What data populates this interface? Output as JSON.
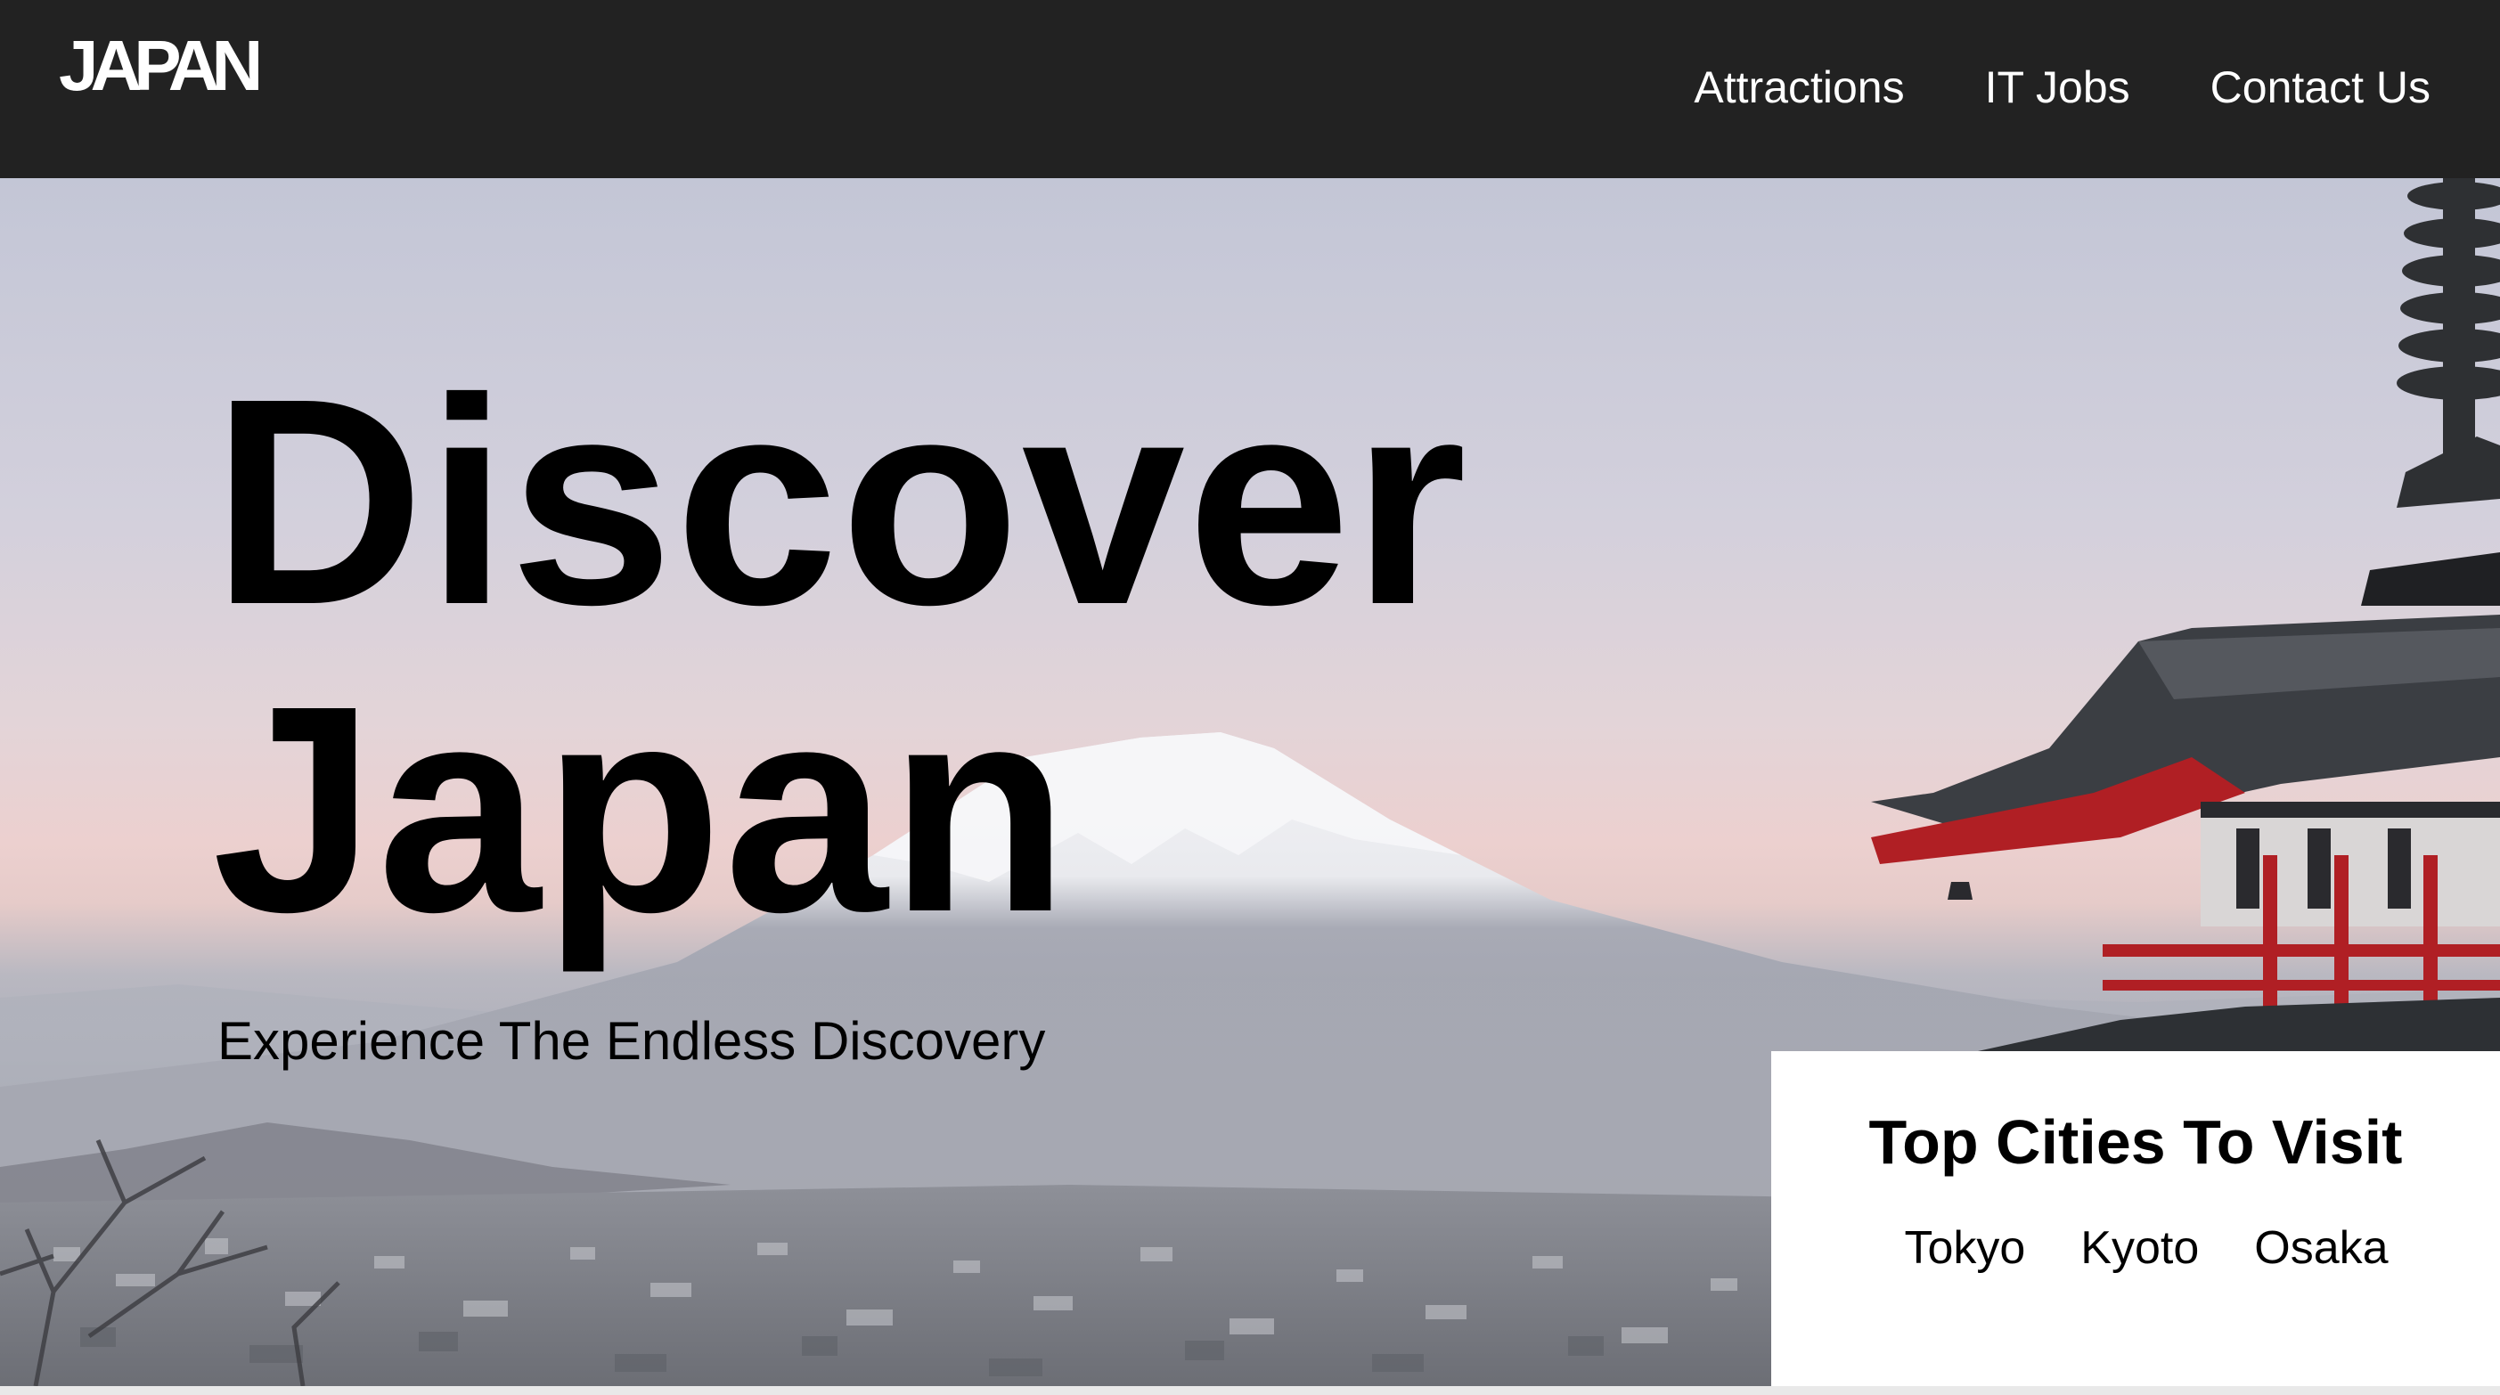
{
  "nav": {
    "logo": "JAPAN",
    "links": [
      "Attractions",
      "IT Jobs",
      "Contact Us"
    ]
  },
  "hero": {
    "title_line1": "Discover",
    "title_line2": "Japan",
    "subtitle": "Experience The Endless Discovery",
    "image_subject": "mount-fuji-pagoda-photo"
  },
  "cities": {
    "title": "Top Cities To Visit",
    "items": [
      "Tokyo",
      "Kyoto",
      "Osaka"
    ]
  },
  "colors": {
    "navbar_bg": "#222222",
    "nav_text": "#ffffff",
    "heading_text": "#000000",
    "card_bg": "#ffffff"
  }
}
